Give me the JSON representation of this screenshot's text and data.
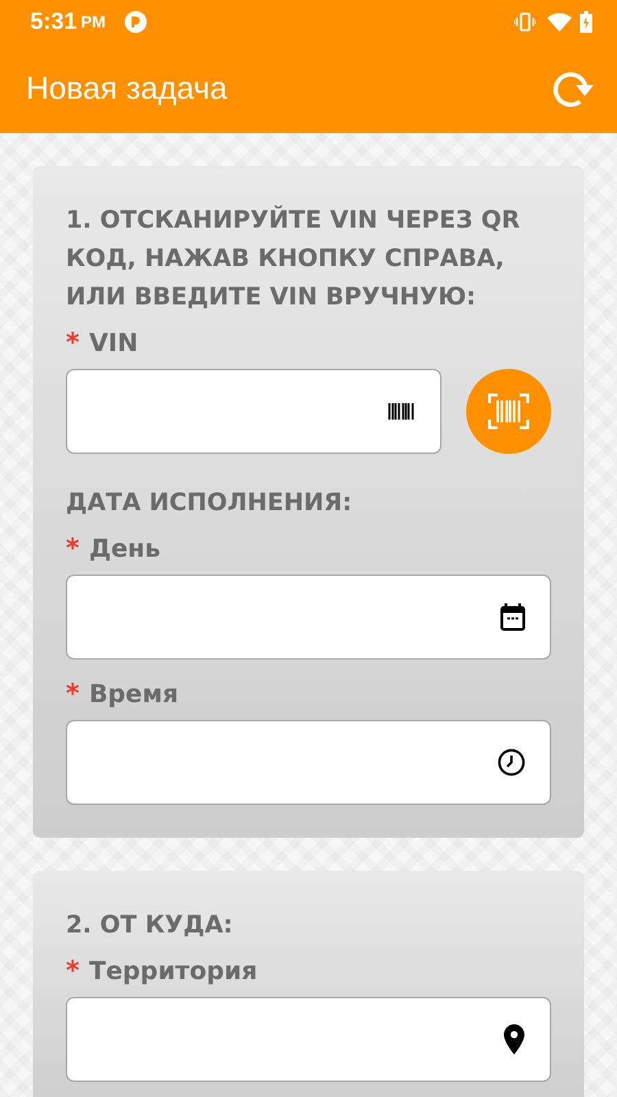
{
  "status_bar": {
    "time": "5:31",
    "ampm": "PM"
  },
  "app_bar": {
    "title": "Новая задача"
  },
  "cards": [
    {
      "sections": [
        {
          "heading": "1. ОТСКАНИРУЙТЕ VIN ЧЕРЕЗ QR КОД, НАЖАВ КНОПКУ СПРАВА, ИЛИ ВВЕДИТЕ VIN ВРУЧНУЮ:",
          "fields": [
            {
              "kind": "barcode",
              "marker": "*",
              "label": "VIN",
              "scan_button": true
            }
          ]
        },
        {
          "heading": "ДАТА ИСПОЛНЕНИЯ:",
          "fields": [
            {
              "kind": "date",
              "marker": "*",
              "label": "День",
              "scan_button": false
            },
            {
              "kind": "time",
              "marker": "*",
              "label": "Время",
              "scan_button": false
            }
          ]
        }
      ]
    },
    {
      "sections": [
        {
          "heading": "2. ОТ КУДА:",
          "fields": [
            {
              "kind": "location",
              "marker": "*",
              "label": "Территория",
              "scan_button": false
            }
          ]
        }
      ]
    }
  ]
}
